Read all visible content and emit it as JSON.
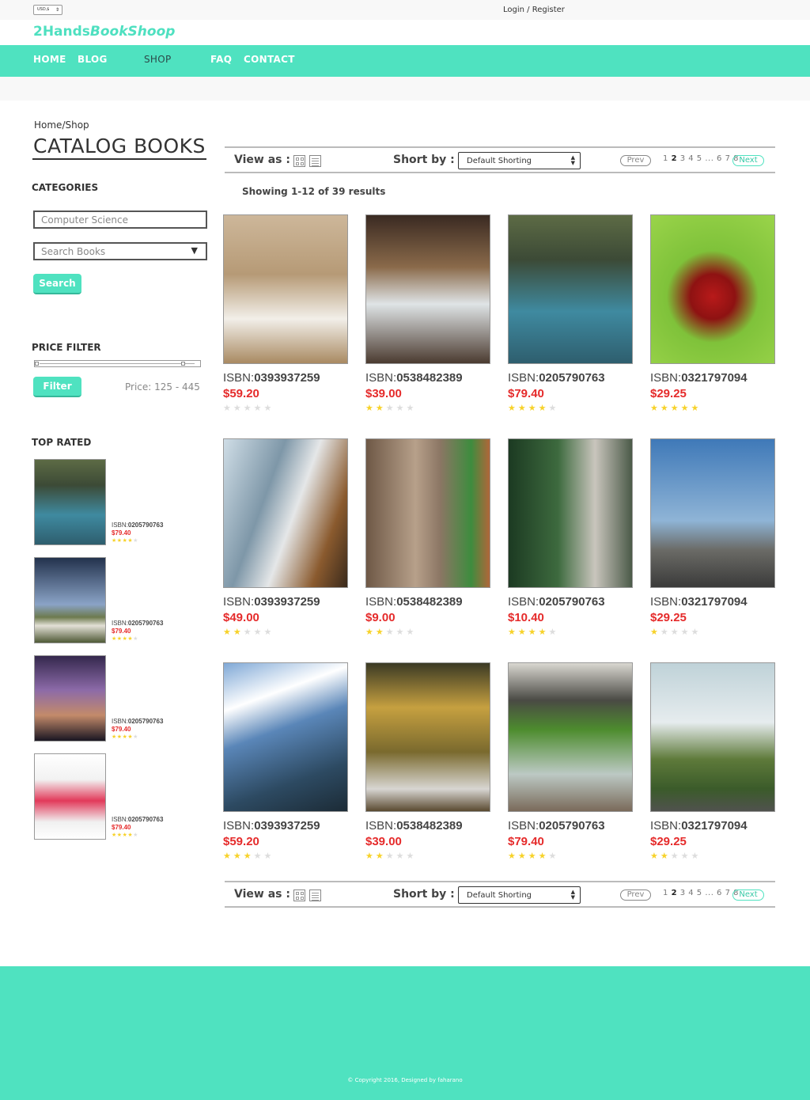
{
  "topbar": {
    "currency": "USD,$",
    "login": "Login / Register"
  },
  "logo": {
    "part1": "2Hands",
    "part2": "BookShoop"
  },
  "nav": [
    "HOME",
    "BLOG",
    "SHOP",
    "FAQ",
    "CONTACT"
  ],
  "nav_active": "SHOP",
  "breadcrumb": "Home/Shop",
  "page_title": "CATALOG BOOKS",
  "sidebar": {
    "categories_title": "CATEGORIES",
    "category_input": "Computer Science",
    "search_placeholder": "Search Books",
    "search_button": "Search",
    "price_title": "PRICE FILTER",
    "filter_button": "Filter",
    "price_label": "Price: 125 - 445",
    "price_range": [
      125,
      445
    ],
    "top_rated_title": "TOP RATED",
    "top_rated": [
      {
        "isbn_label": "ISBN:",
        "isbn": "0205790763",
        "price": "$79.40",
        "rating": 4,
        "image": "woman-covering-face"
      },
      {
        "isbn_label": "ISBN:",
        "isbn": "0205790763",
        "price": "$79.40",
        "rating": 4,
        "image": "country-road"
      },
      {
        "isbn_label": "ISBN:",
        "isbn": "0205790763",
        "price": "$79.40",
        "rating": 4,
        "image": "purple-sunset-city"
      },
      {
        "isbn_label": "ISBN:",
        "isbn": "0205790763",
        "price": "$79.40",
        "rating": 4,
        "image": "red-cocktail"
      }
    ]
  },
  "toolbar": {
    "view_as": "View as :",
    "sort_by": "Short by :",
    "sort_value": "Default Shorting",
    "prev": "Prev",
    "next": "Next",
    "pages_before": "1",
    "current_page": "2",
    "pages_after": "3 4 5 ... 6 7 8"
  },
  "showing": "Showing 1-12 of 39 results",
  "products": [
    {
      "isbn_label": "ISBN:",
      "isbn": "0393937259",
      "price": "$59.20",
      "rating": 0,
      "image": "girl-with-cake"
    },
    {
      "isbn_label": "ISBN:",
      "isbn": "0538482389",
      "price": "$39.00",
      "rating": 2,
      "image": "coffee-shop"
    },
    {
      "isbn_label": "ISBN:",
      "isbn": "0205790763",
      "price": "$79.40",
      "rating": 4,
      "image": "woman-covering-face"
    },
    {
      "isbn_label": "ISBN:",
      "isbn": "0321797094",
      "price": "$29.25",
      "rating": 5,
      "image": "wild-strawberry"
    },
    {
      "isbn_label": "ISBN:",
      "isbn": "0393937259",
      "price": "$49.00",
      "rating": 2,
      "image": "curtain"
    },
    {
      "isbn_label": "ISBN:",
      "isbn": "0538482389",
      "price": "$9.00",
      "rating": 2,
      "image": "tree-trunk-child"
    },
    {
      "isbn_label": "ISBN:",
      "isbn": "0205790763",
      "price": "$10.40",
      "rating": 4,
      "image": "couple-walking-path"
    },
    {
      "isbn_label": "ISBN:",
      "isbn": "0321797094",
      "price": "$29.25",
      "rating": 1,
      "image": "city-cranes"
    },
    {
      "isbn_label": "ISBN:",
      "isbn": "0393937259",
      "price": "$59.20",
      "rating": 3,
      "image": "skyscraper-sky"
    },
    {
      "isbn_label": "ISBN:",
      "isbn": "0538482389",
      "price": "$39.00",
      "rating": 2,
      "image": "autumn-tree-garden"
    },
    {
      "isbn_label": "ISBN:",
      "isbn": "0205790763",
      "price": "$79.40",
      "rating": 4,
      "image": "bicycle-ivy-wall"
    },
    {
      "isbn_label": "ISBN:",
      "isbn": "0321797094",
      "price": "$29.25",
      "rating": 2,
      "image": "green-valley"
    }
  ],
  "footer": {
    "copyright": "© Copyright 2016, Designed by faharano"
  },
  "colors": {
    "accent": "#4fe2c0",
    "price": "#e52b2b",
    "star": "#f7d22a",
    "star_off": "#dddddd"
  }
}
